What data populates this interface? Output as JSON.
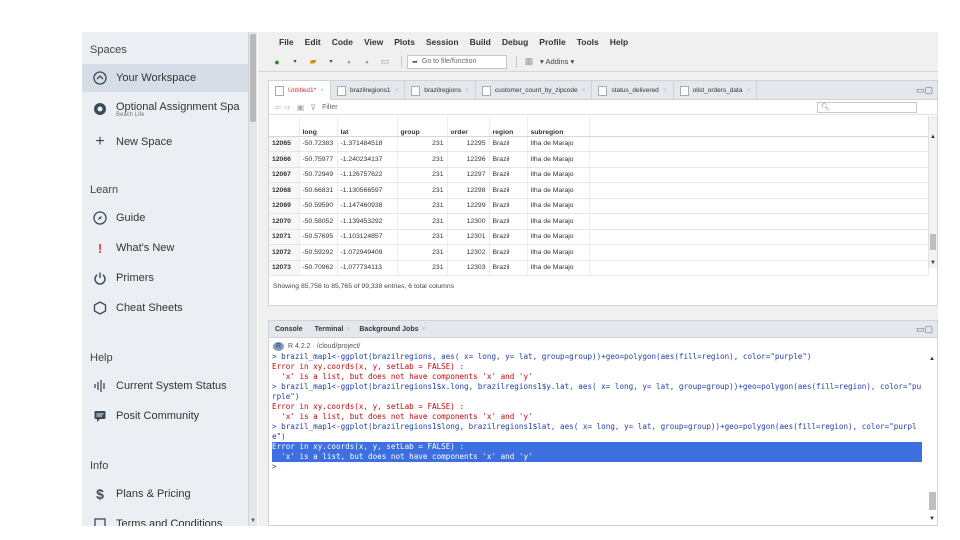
{
  "sidebar": {
    "spaces_title": "Spaces",
    "your_workspace": "Your Workspace",
    "optional_space": "Optional Assignment Spa",
    "optional_space_sub": "Beach Life",
    "new_space": "New Space",
    "learn_title": "Learn",
    "guide": "Guide",
    "whats_new": "What's New",
    "primers": "Primers",
    "cheat_sheets": "Cheat Sheets",
    "help_title": "Help",
    "system_status": "Current System Status",
    "posit_community": "Posit Community",
    "info_title": "Info",
    "plans_pricing": "Plans & Pricing",
    "terms": "Terms and Conditions"
  },
  "menubar": [
    "File",
    "Edit",
    "Code",
    "View",
    "Plots",
    "Session",
    "Build",
    "Debug",
    "Profile",
    "Tools",
    "Help"
  ],
  "toolbar": {
    "goto_placeholder": "Go to file/function",
    "addins": "Addins"
  },
  "source_tabs": [
    {
      "label": "Untitled1*",
      "active": true
    },
    {
      "label": "brazilregions1",
      "active": false
    },
    {
      "label": "brazilregions",
      "active": false
    },
    {
      "label": "customer_count_by_zipcode",
      "active": false
    },
    {
      "label": "status_delivered",
      "active": false
    },
    {
      "label": "olist_orders_data",
      "active": false
    }
  ],
  "filter_label": "Filter",
  "search_placeholder": "",
  "grid": {
    "columns": [
      "",
      "long",
      "lat",
      "group",
      "order",
      "region",
      "subregion"
    ],
    "rows": [
      [
        "12065",
        "-50.72383",
        "-1.371484518",
        "231",
        "12295",
        "Brazil",
        "Ilha de Marajo"
      ],
      [
        "12066",
        "-50.75977",
        "-1.240234137",
        "231",
        "12296",
        "Brazil",
        "Ilha de Marajo"
      ],
      [
        "12067",
        "-50.72949",
        "-1.126757622",
        "231",
        "12297",
        "Brazil",
        "Ilha de Marajo"
      ],
      [
        "12068",
        "-50.66831",
        "-1.130566597",
        "231",
        "12298",
        "Brazil",
        "Ilha de Marajo"
      ],
      [
        "12069",
        "-50.59590",
        "-1.147460938",
        "231",
        "12299",
        "Brazil",
        "Ilha de Marajo"
      ],
      [
        "12070",
        "-50.58052",
        "-1.139453292",
        "231",
        "12300",
        "Brazil",
        "Ilha de Marajo"
      ],
      [
        "12071",
        "-50.57695",
        "-1.103124857",
        "231",
        "12301",
        "Brazil",
        "Ilha de Marajo"
      ],
      [
        "12072",
        "-50.59292",
        "-1.072949409",
        "231",
        "12302",
        "Brazil",
        "Ilha de Marajo"
      ],
      [
        "12073",
        "-50.70962",
        "-1.077734113",
        "231",
        "12303",
        "Brazil",
        "Ilha de Marajo"
      ]
    ],
    "info": "Showing 85,756 to 85,765 of 99,338 entries, 6 total columns"
  },
  "console": {
    "tabs": [
      "Console",
      "Terminal",
      "Background Jobs"
    ],
    "r_version": "R 4.2.2 · /cloud/project/",
    "lines": [
      {
        "type": "cmd",
        "text": "> brazil_map1<-ggplot(brazilregions, aes( x= long, y= lat, group=group))+geo=polygon(aes(fill=region), color=\"purple\")"
      },
      {
        "type": "err",
        "text": "Error in xy.coords(x, y, setLab = FALSE) :\n  'x' is a list, but does not have components 'x' and 'y'"
      },
      {
        "type": "cmd",
        "text": "> brazil_map1<-ggplot(brazilregions1$x.long, brazilregions1$y.lat, aes( x= long, y= lat, group=group))+geo=polygon(aes(fill=region), color=\"purple\")"
      },
      {
        "type": "err",
        "text": "Error in xy.coords(x, y, setLab = FALSE) :\n  'x' is a list, but does not have components 'x' and 'y'"
      },
      {
        "type": "cmd",
        "text": "> brazil_map1<-ggplot(brazilregions1$long, brazilregions1$lat, aes( x= long, y= lat, group=group))+geo=polygon(aes(fill=region), color=\"purple\")"
      },
      {
        "type": "err-sel",
        "text": "Error in xy.coords(x, y, setLab = FALSE) :\n  'x' is a list, but does not have components 'x' and 'y'"
      },
      {
        "type": "cmd",
        "text": "> "
      }
    ]
  }
}
